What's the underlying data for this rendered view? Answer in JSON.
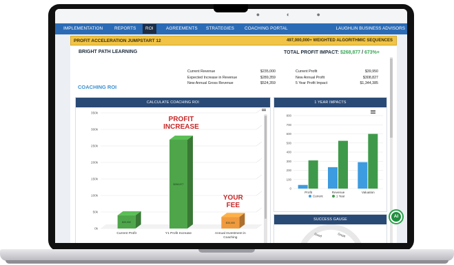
{
  "nav": {
    "items": [
      {
        "label": "IMPLEMENTATION",
        "active": false
      },
      {
        "label": "REPORTS",
        "active": false
      },
      {
        "label": "ROI",
        "active": true
      },
      {
        "label": "AGREEMENTS",
        "active": false
      },
      {
        "label": "STRATEGIES",
        "active": false
      },
      {
        "label": "COACHING PORTAL",
        "active": false
      }
    ],
    "brand": "LAUGHLIN BUSINESS ADVISORS"
  },
  "banner": {
    "title": "PROFIT ACCELERATION JUMPSTART 12",
    "subtitle": "497,000,000+ WEIGHTED ALGORITHMIC SEQUENCES"
  },
  "company": "BRIGHT PATH LEARNING",
  "impact": {
    "label": "TOTAL PROFIT IMPACT:",
    "value": "$268,877",
    "separator": "/",
    "percent": "673%+"
  },
  "metrics_left": [
    {
      "label": "Current Revenue",
      "value": "$235,000"
    },
    {
      "label": "Expected Increase in Revenue",
      "value": "$289,359"
    },
    {
      "label": "New Annual Gross Revenue",
      "value": "$524,359"
    }
  ],
  "metrics_right": [
    {
      "label": "Current Profit",
      "value": "$39,950"
    },
    {
      "label": "New Annual Profit",
      "value": "$308,827"
    },
    {
      "label": "5 Year Profit Impact",
      "value": "$1,344,385"
    }
  ],
  "section_title": "COACHING ROI",
  "roi_card": {
    "title": "CALCULATE COACHING ROI"
  },
  "impacts_card": {
    "title": "1 YEAR IMPACTS"
  },
  "gauge_card": {
    "title": "SUCCESS GAUGE",
    "labels": [
      "Good",
      "Great"
    ]
  },
  "ai_button": {
    "label": "AI"
  },
  "chart_data": [
    {
      "type": "bar",
      "title": "",
      "categories": [
        "Current Profit",
        "Y1 Profit Increase",
        "Annual Investment in Coaching"
      ],
      "values": [
        39950,
        268877,
        35000
      ],
      "ylim": [
        0,
        350000
      ],
      "yticks": [
        "0k",
        "50k",
        "100k",
        "150k",
        "200k",
        "250k",
        "300k",
        "350k"
      ],
      "annotations": {
        "profit_increase": [
          "PROFIT",
          "INCREASE"
        ],
        "your_fee": [
          "YOUR",
          "FEE"
        ]
      },
      "data_labels": [
        "$39,950",
        "$268,877",
        "$35,000"
      ],
      "colors": {
        "green": "#4fa64a",
        "orange": "#f09a3e",
        "annotation_red": "#c62828"
      },
      "grid": true
    },
    {
      "type": "bar",
      "title": "",
      "categories": [
        "Profit",
        "Revenue",
        "Valuation"
      ],
      "series": [
        {
          "name": "Current",
          "values": [
            40,
            235,
            290
          ],
          "color": "#3d9be0"
        },
        {
          "name": "1 Year",
          "values": [
            309,
            524,
            600
          ],
          "color": "#3e9a4a"
        }
      ],
      "ylim": [
        0,
        800
      ],
      "yticks": [
        "0",
        "100",
        "200",
        "300",
        "400",
        "500",
        "600",
        "700",
        "800"
      ],
      "legend": "bottom",
      "grid": true
    }
  ]
}
